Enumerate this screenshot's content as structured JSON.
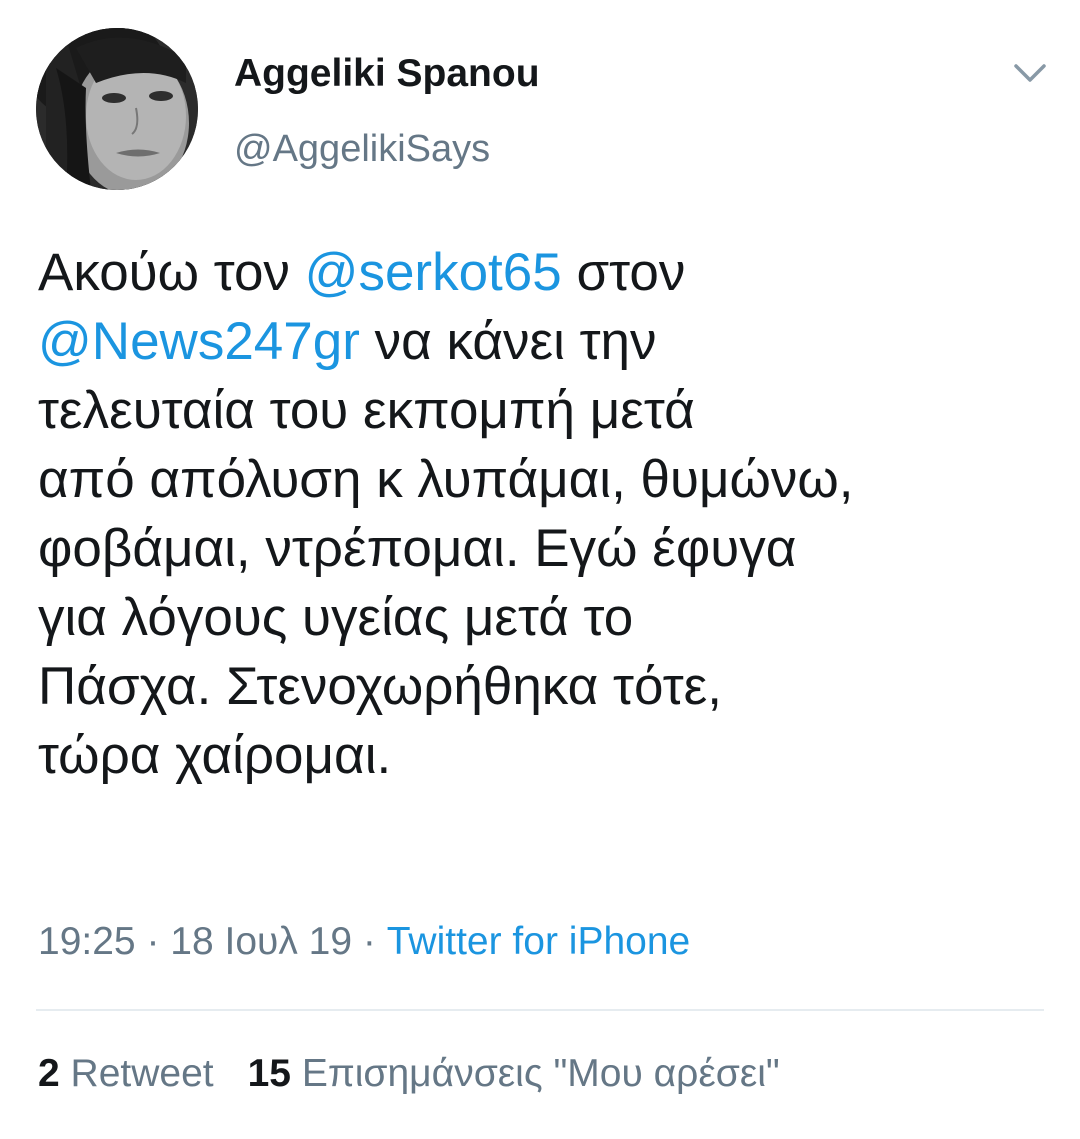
{
  "tweet": {
    "author": {
      "display_name": "Aggeliki Spanou",
      "handle": "@AggelikiSays"
    },
    "text_lines": [
      [
        {
          "text": "Ακούω τον ",
          "type": "text"
        },
        {
          "text": "@serkot65",
          "type": "mention"
        },
        {
          "text": " στον",
          "type": "text"
        }
      ],
      [
        {
          "text": "@News247gr",
          "type": "mention"
        },
        {
          "text": " να κάνει την",
          "type": "text"
        }
      ],
      [
        {
          "text": "τελευταία του εκπομπή μετά",
          "type": "text"
        }
      ],
      [
        {
          "text": "από απόλυση κ λυπάμαι, θυμώνω,",
          "type": "text"
        }
      ],
      [
        {
          "text": "φοβάμαι, ντρέπομαι. Εγώ έφυγα",
          "type": "text"
        }
      ],
      [
        {
          "text": "για λόγους υγείας μετά το",
          "type": "text"
        }
      ],
      [
        {
          "text": "Πάσχα. Στενοχωρήθηκα τότε,",
          "type": "text"
        }
      ],
      [
        {
          "text": "τώρα χαίρομαι.",
          "type": "text"
        }
      ]
    ],
    "meta": {
      "time": "19:25",
      "separator": " · ",
      "date": "18 Ιουλ 19",
      "source": "Twitter for iPhone"
    },
    "stats": {
      "retweets_count": "2",
      "retweets_label": " Retweet",
      "likes_count": "15",
      "likes_label": " Επισημάνσεις \"Μου αρέσει\""
    }
  },
  "icons": {
    "menu": "chevron-down-icon"
  },
  "colors": {
    "text": "#14171a",
    "secondary": "#657786",
    "link": "#1b95e0",
    "divider": "#e6ecf0"
  }
}
